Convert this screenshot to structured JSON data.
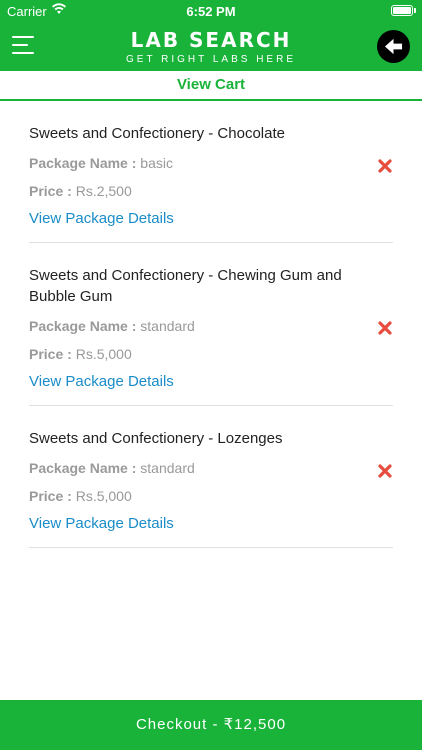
{
  "status": {
    "carrier": "Carrier",
    "time": "6:52 PM"
  },
  "header": {
    "title": "LAB SEARCH",
    "subtitle": "GET RIGHT LABS HERE",
    "menu_icon": "hamburger-icon",
    "back_icon": "arrow-left-icon"
  },
  "tab": {
    "label": "View Cart"
  },
  "cart": {
    "items": [
      {
        "name": "Sweets and Confectionery - Chocolate",
        "package_label": "Package Name :",
        "package": "basic",
        "price_label": "Price :",
        "price": "Rs.2,500",
        "details_link": "View Package Details"
      },
      {
        "name": "Sweets and Confectionery - Chewing Gum and Bubble Gum",
        "package_label": "Package Name :",
        "package": "standard",
        "price_label": "Price :",
        "price": "Rs.5,000",
        "details_link": "View Package Details"
      },
      {
        "name": "Sweets and Confectionery - Lozenges",
        "package_label": "Package Name :",
        "package": "standard",
        "price_label": "Price :",
        "price": "Rs.5,000",
        "details_link": "View Package Details"
      }
    ]
  },
  "checkout": {
    "label": "Checkout - ₹12,500"
  },
  "colors": {
    "brand_green": "#19b33a",
    "link_blue": "#1a8cc7",
    "remove_red": "#e74c3c"
  }
}
